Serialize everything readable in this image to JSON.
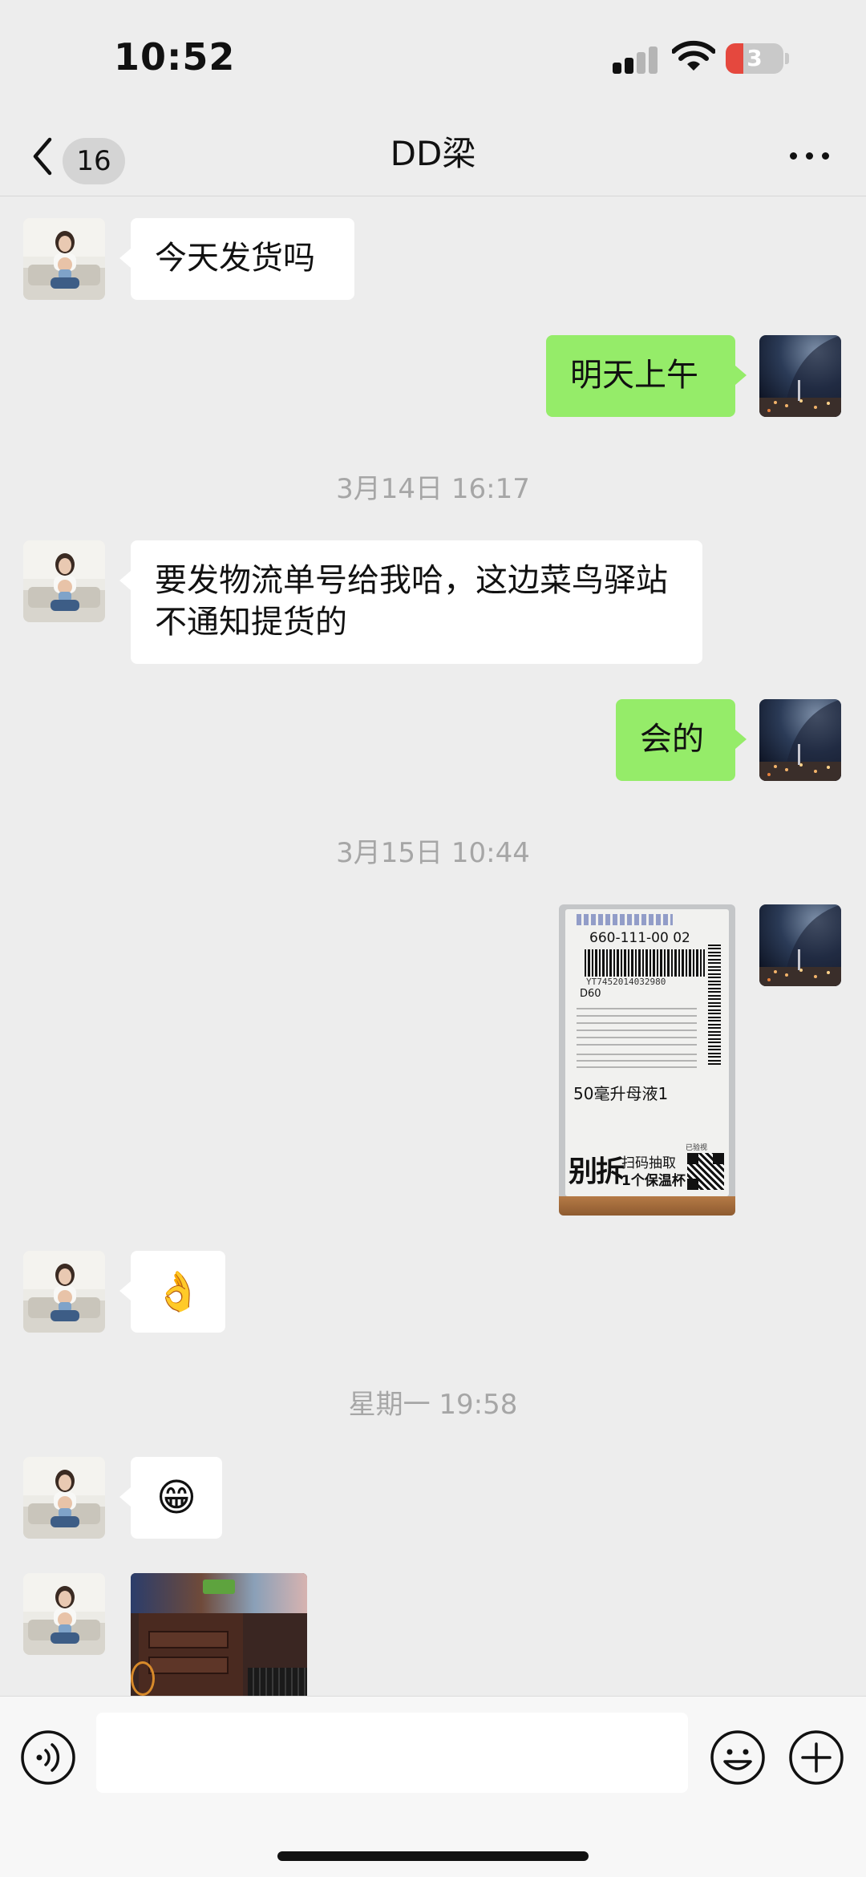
{
  "status_bar": {
    "time": "10:52",
    "battery_level": "3"
  },
  "nav": {
    "back_count": "16",
    "title": "DD梁"
  },
  "messages": [
    {
      "side": "in",
      "text": "今天发货吗"
    },
    {
      "side": "out",
      "text": "明天上午"
    },
    {
      "type": "timestamp",
      "text": "3月14日 16:17"
    },
    {
      "side": "in",
      "text": "要发物流单号给我哈，这边菜鸟驿站不通知提货的"
    },
    {
      "side": "out",
      "text": "会的"
    },
    {
      "type": "timestamp",
      "text": "3月15日 10:44"
    },
    {
      "side": "out",
      "type": "image",
      "label": {
        "code": "660-111-00 02",
        "tracking": "YT7452014032980",
        "route": "D60",
        "product": "50毫升母液1",
        "promo_big": "别拆",
        "promo_line1": "扫码抽取",
        "promo_line2": "1个保温杯",
        "corner": "已验视"
      }
    },
    {
      "side": "in",
      "type": "emoji",
      "emoji": "👌"
    },
    {
      "type": "timestamp",
      "text": "星期一 19:58"
    },
    {
      "side": "in",
      "type": "emoji",
      "emoji": "😁"
    },
    {
      "side": "in",
      "type": "image"
    }
  ],
  "input": {
    "placeholder": ""
  },
  "icons": {
    "back": "chevron-left-icon",
    "more": "more-dots-icon",
    "voice": "voice-icon",
    "emoji": "emoji-icon",
    "plus": "plus-icon"
  },
  "colors": {
    "background": "#ededed",
    "outgoing_bubble": "#95ec69",
    "incoming_bubble": "#ffffff",
    "timestamp": "#a6a6a6",
    "battery_low": "#e5483e"
  }
}
